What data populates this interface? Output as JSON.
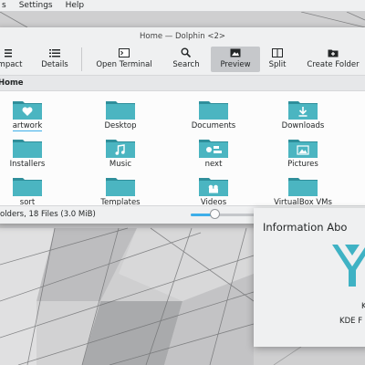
{
  "menubar": {
    "items": [
      "s",
      "Settings",
      "Help"
    ]
  },
  "window": {
    "title": "Home — Dolphin <2>",
    "toolbar": [
      {
        "label": "mpact",
        "icon": "compact-view-icon"
      },
      {
        "label": "Details",
        "icon": "details-view-icon"
      },
      {
        "label": "Open Terminal",
        "icon": "terminal-icon"
      },
      {
        "label": "Search",
        "icon": "search-icon"
      },
      {
        "label": "Preview",
        "icon": "preview-icon",
        "active": true
      },
      {
        "label": "Split",
        "icon": "split-icon"
      },
      {
        "label": "Create Folder",
        "icon": "new-folder-icon"
      }
    ],
    "path": "Home",
    "files": [
      {
        "name": "artwork",
        "emblem": "heart",
        "selected": true
      },
      {
        "name": "Desktop",
        "emblem": "none"
      },
      {
        "name": "Documents",
        "emblem": "none"
      },
      {
        "name": "Downloads",
        "emblem": "download"
      },
      {
        "name": "Installers",
        "emblem": "none"
      },
      {
        "name": "Music",
        "emblem": "music"
      },
      {
        "name": "next",
        "emblem": "next"
      },
      {
        "name": "Pictures",
        "emblem": "pictures"
      },
      {
        "name": "sort",
        "emblem": "none"
      },
      {
        "name": "Templates",
        "emblem": "none"
      },
      {
        "name": "Videos",
        "emblem": "videos"
      },
      {
        "name": "VirtualBox VMs",
        "emblem": "none"
      }
    ],
    "status": "olders, 18 Files (3.0 MiB)",
    "zoom_fraction": 0.23
  },
  "about": {
    "title": "Information Abo",
    "line1": "K",
    "line2": "KDE F"
  },
  "colors": {
    "accent": "#3daee9",
    "folder": "#4bb5c1",
    "folder_dark": "#2f8f9b"
  }
}
